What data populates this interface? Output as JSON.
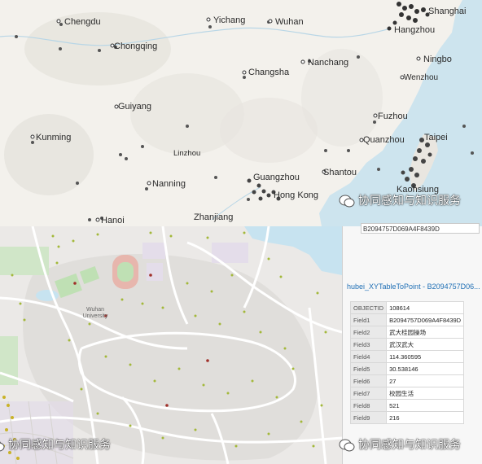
{
  "top_map": {
    "cities": [
      {
        "name": "Chengdu"
      },
      {
        "name": "Yichang"
      },
      {
        "name": "Wuhan"
      },
      {
        "name": "Shanghai"
      },
      {
        "name": "Hangzhou"
      },
      {
        "name": "Ningbo"
      },
      {
        "name": "Chongqing"
      },
      {
        "name": "Nanchang"
      },
      {
        "name": "Changsha"
      },
      {
        "name": "Wenzhou"
      },
      {
        "name": "Guiyang"
      },
      {
        "name": "Fuzhou"
      },
      {
        "name": "Kunming"
      },
      {
        "name": "Quanzhou"
      },
      {
        "name": "Taipei"
      },
      {
        "name": "Linzhou"
      },
      {
        "name": "Nanning"
      },
      {
        "name": "Guangzhou"
      },
      {
        "name": "Shantou"
      },
      {
        "name": "Hong Kong"
      },
      {
        "name": "Kaohsiung"
      },
      {
        "name": "Hanoi"
      },
      {
        "name": "Zhanjiang"
      }
    ],
    "watermark": "协同感知与知识服务"
  },
  "bottom_map": {
    "campus_label": [
      "Wuhan",
      "University"
    ],
    "watermark": "协同感知与知识服务"
  },
  "attribute_panel": {
    "id_value": "B2094757D069A4F8439D",
    "title": "hubei_XYTableToPoint - B2094757D06...",
    "fields": [
      {
        "key": "OBJECTID",
        "value": "108614"
      },
      {
        "key": "Field1",
        "value": "B2094757D069A4F8439D"
      },
      {
        "key": "Field2",
        "value": "武大桂园操场"
      },
      {
        "key": "Field3",
        "value": "武汉武大"
      },
      {
        "key": "Field4",
        "value": "114.360595"
      },
      {
        "key": "Field5",
        "value": "30.538146"
      },
      {
        "key": "Field6",
        "value": "27"
      },
      {
        "key": "Field7",
        "value": "校园生活"
      },
      {
        "key": "Field8",
        "value": "521"
      },
      {
        "key": "Field9",
        "value": "216"
      }
    ]
  }
}
